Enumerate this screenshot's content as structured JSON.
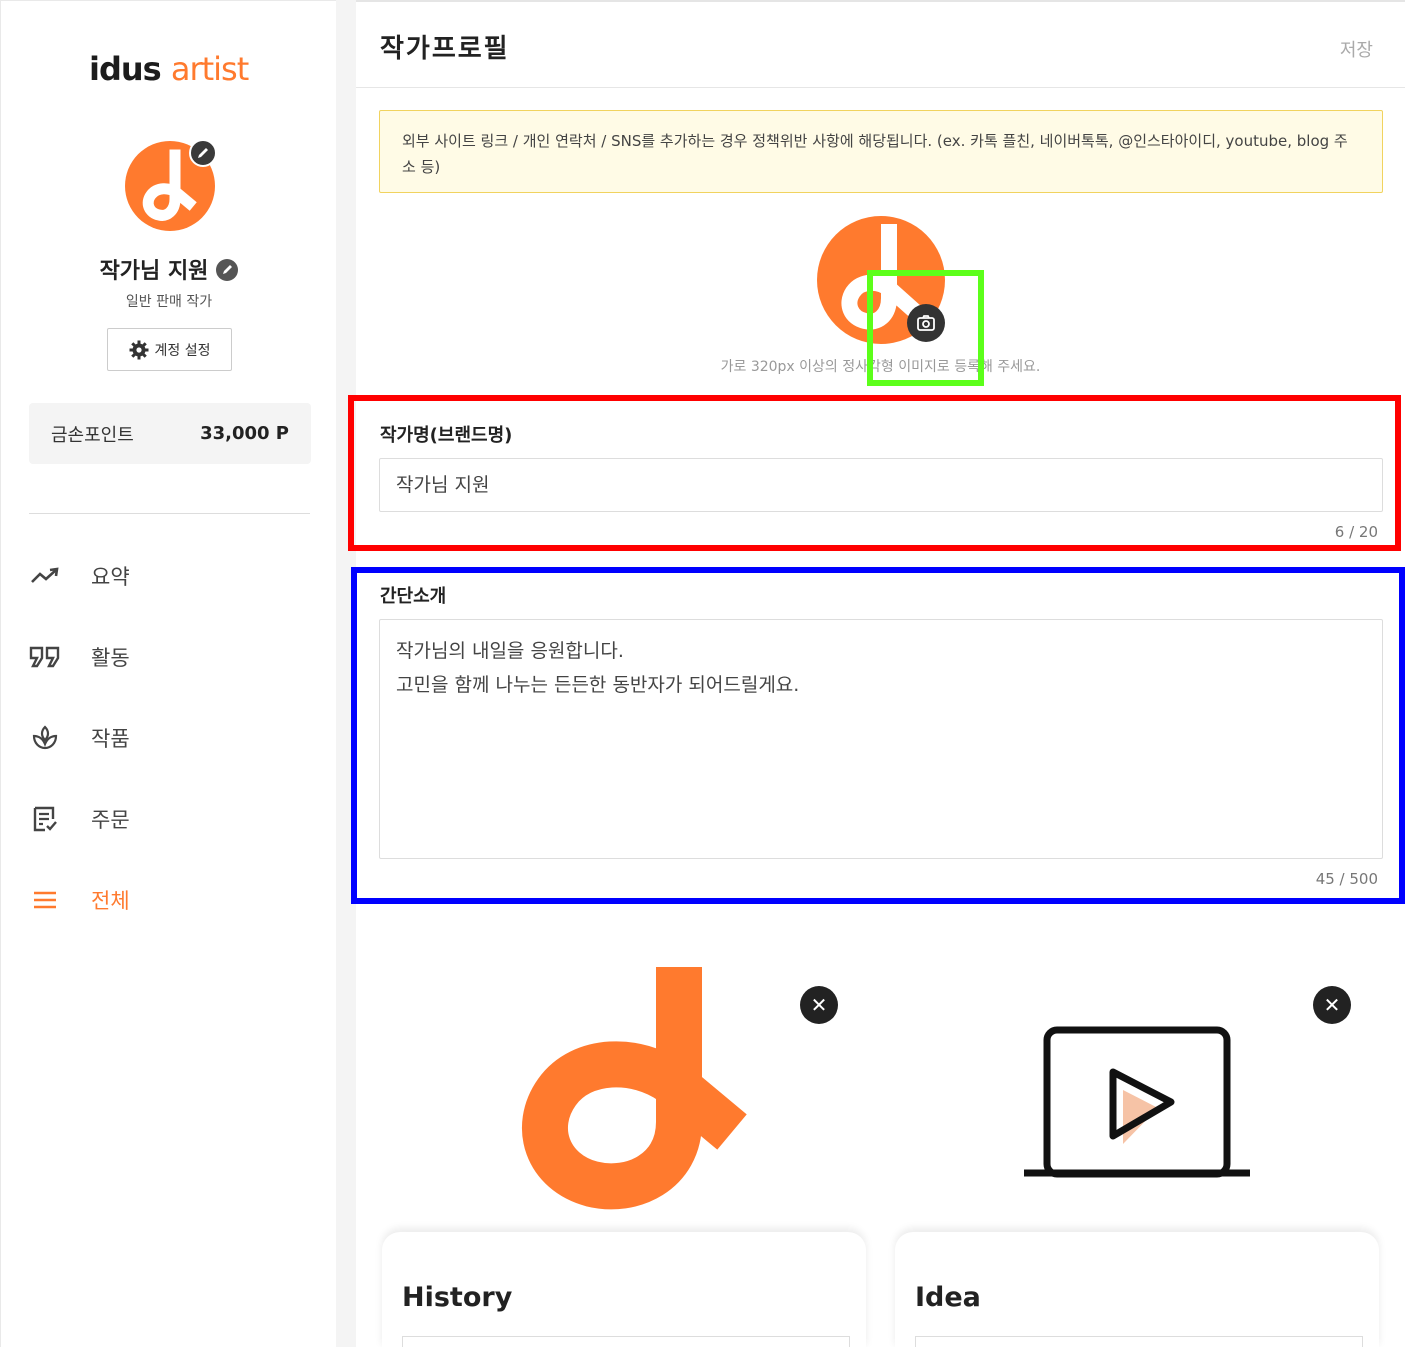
{
  "sidebar": {
    "logo_dark": "idus",
    "logo_orange": "artist",
    "artist_name": "작가님 지원",
    "artist_role": "일반 판매 작가",
    "account_button": "계정 설정",
    "points_label": "금손포인트",
    "points_value": "33,000 P",
    "nav": [
      {
        "label": "요약",
        "icon": "trend-icon"
      },
      {
        "label": "활동",
        "icon": "quote-icon"
      },
      {
        "label": "작품",
        "icon": "plant-icon"
      },
      {
        "label": "주문",
        "icon": "order-icon"
      },
      {
        "label": "전체",
        "icon": "menu-icon",
        "active": true
      }
    ]
  },
  "header": {
    "title": "작가프로필",
    "save": "저장"
  },
  "notice": "외부 사이트 링크 / 개인 연락처 / SNS를 추가하는 경우 정책위반 사항에 해당됩니다. (ex. 카톡 플친, 네이버톡톡, @인스타아이디, youtube, blog 주소 등)",
  "profile_image_hint": "가로 320px 이상의 정사각형 이미지로 등록해 주세요.",
  "brand_name": {
    "label": "작가명(브랜드명)",
    "value": "작가님 지원",
    "counter": "6 / 20"
  },
  "intro": {
    "label": "간단소개",
    "line1": "작가님의 내일을 응원합니다.",
    "line2": "고민을 함께 나누는 든든한 동반자가 되어드릴게요.",
    "counter": "45 / 500"
  },
  "cards": [
    {
      "title": "History",
      "close": "✕"
    },
    {
      "title": "Idea",
      "close": "✕"
    }
  ],
  "colors": {
    "brand_orange": "#ff7a2e",
    "notice_bg": "#fffbe6",
    "highlight_red": "#ff0000",
    "highlight_blue": "#0000ff",
    "highlight_green": "#5cff1a"
  }
}
